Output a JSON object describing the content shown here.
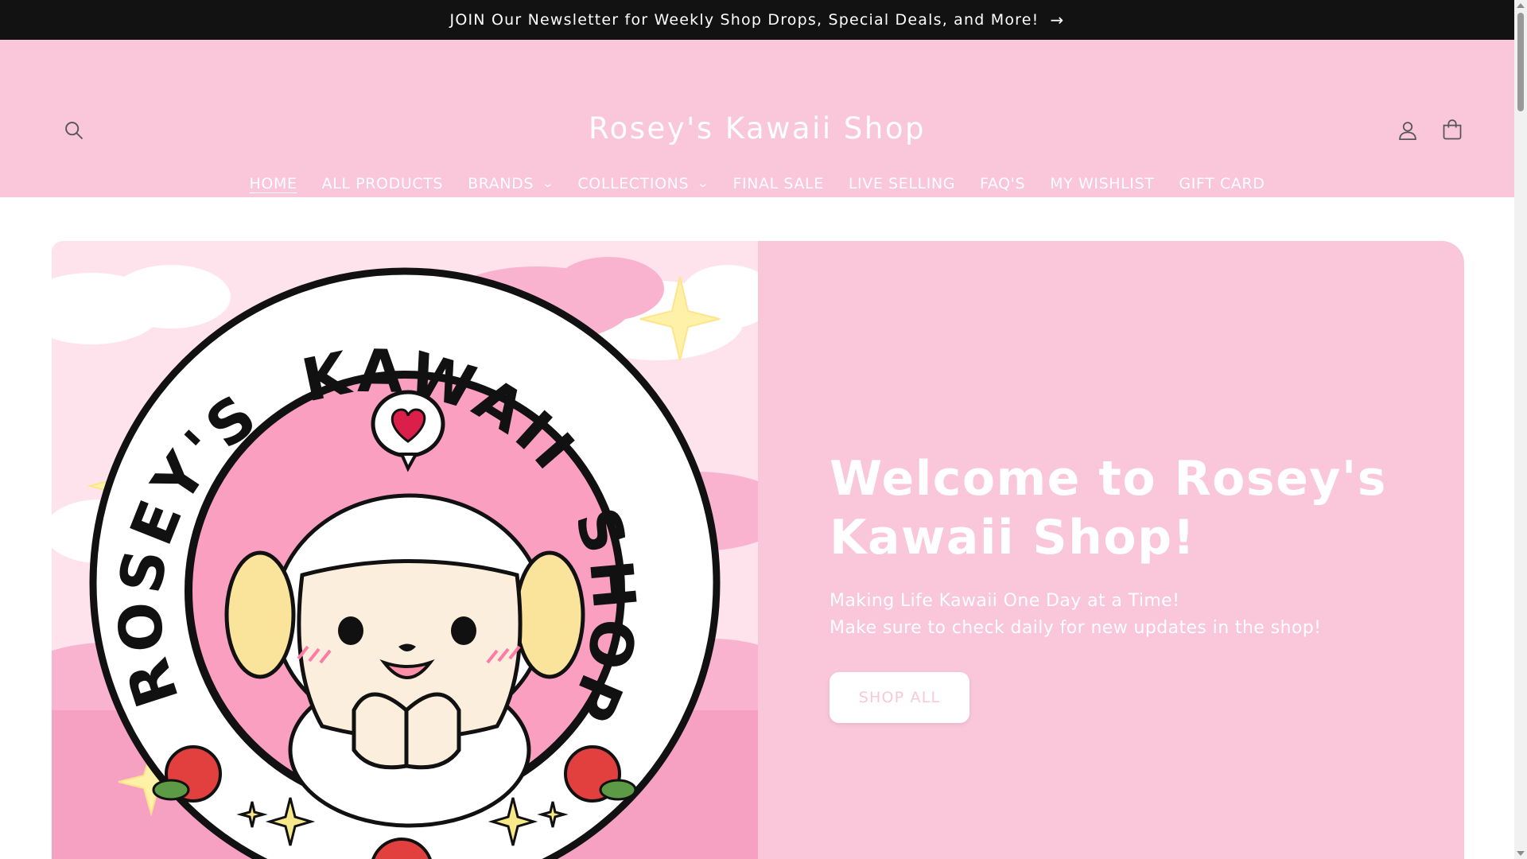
{
  "announcement": {
    "text": "JOIN Our Newsletter for Weekly Shop Drops, Special Deals, and More!",
    "arrow": "→"
  },
  "header": {
    "logo": "Rosey's Kawaii Shop",
    "icons": [
      "search-icon",
      "account-icon",
      "cart-icon"
    ],
    "nav": [
      {
        "label": "HOME",
        "active": true
      },
      {
        "label": "ALL PRODUCTS"
      },
      {
        "label": "BRANDS",
        "dropdown": true
      },
      {
        "label": "COLLECTIONS",
        "dropdown": true
      },
      {
        "label": "FINAL SALE"
      },
      {
        "label": "LIVE SELLING"
      },
      {
        "label": "FAQ'S"
      },
      {
        "label": "MY WISHLIST"
      },
      {
        "label": "GIFT CARD"
      }
    ]
  },
  "hero": {
    "heading": "Welcome to Rosey's Kawaii Shop!",
    "line1": "Making Life Kawaii One Day at a Time!",
    "line2": "Make sure to check daily for new updates in the shop!",
    "button": "SHOP ALL",
    "logo_art": {
      "ring_text_left": "ROSEY'S",
      "ring_text_top": "KAWAII",
      "ring_text_right": "SHOP"
    }
  },
  "colors": {
    "announcement_bg": "#121212",
    "brand_pink": "#f9c6da",
    "white": "#ffffff"
  }
}
